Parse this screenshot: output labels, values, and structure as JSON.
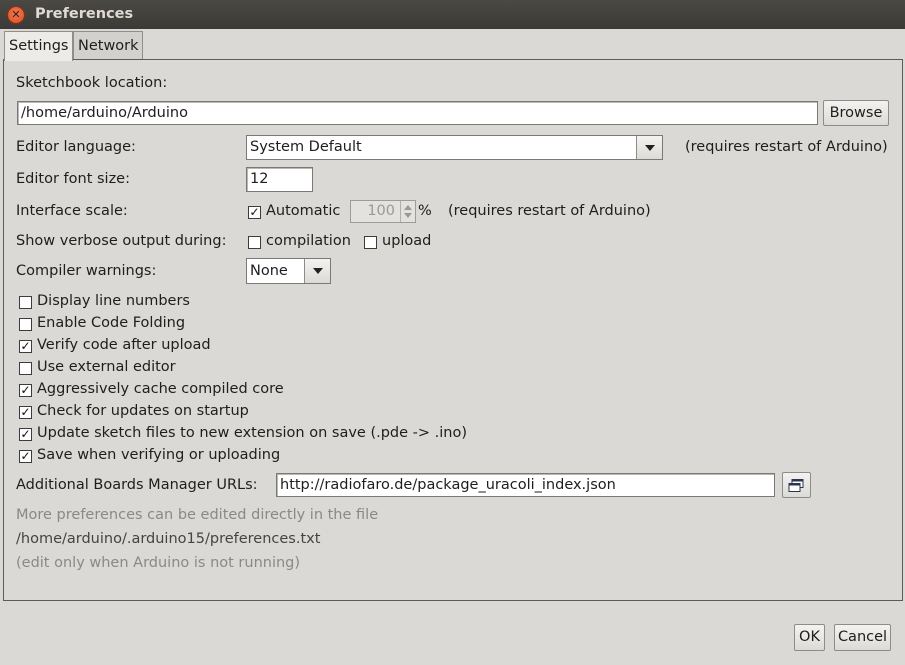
{
  "window": {
    "title": "Preferences"
  },
  "tabs": [
    {
      "label": "Settings"
    },
    {
      "label": "Network"
    }
  ],
  "settings": {
    "sketchbook_label": "Sketchbook location:",
    "sketchbook_value": "/home/arduino/Arduino",
    "browse_label": "Browse",
    "editor_language_label": "Editor language:",
    "editor_language_value": "System Default",
    "editor_language_note": "(requires restart of Arduino)",
    "font_size_label": "Editor font size:",
    "font_size_value": "12",
    "interface_scale_label": "Interface scale:",
    "automatic_label": "Automatic",
    "automatic_checked": true,
    "scale_value": "100",
    "scale_unit": "%",
    "scale_note": "(requires restart of Arduino)",
    "verbose_label": "Show verbose output during:",
    "compilation_label": "compilation",
    "compilation_checked": false,
    "upload_label": "upload",
    "upload_checked": false,
    "compiler_warnings_label": "Compiler warnings:",
    "compiler_warnings_value": "None",
    "checkboxes": [
      {
        "label": "Display line numbers",
        "checked": false
      },
      {
        "label": "Enable Code Folding",
        "checked": false
      },
      {
        "label": "Verify code after upload",
        "checked": true
      },
      {
        "label": "Use external editor",
        "checked": false
      },
      {
        "label": "Aggressively cache compiled core",
        "checked": true
      },
      {
        "label": "Check for updates on startup",
        "checked": true
      },
      {
        "label": "Update sketch files to new extension on save (.pde -> .ino)",
        "checked": true
      },
      {
        "label": "Save when verifying or uploading",
        "checked": true
      }
    ],
    "boards_url_label": "Additional Boards Manager URLs:",
    "boards_url_value": "http://radiofaro.de/package_uracoli_index.json",
    "more_prefs_note": "More preferences can be edited directly in the file",
    "prefs_path": "/home/arduino/.arduino15/preferences.txt",
    "edit_note": "(edit only when Arduino is not running)"
  },
  "footer": {
    "ok_label": "OK",
    "cancel_label": "Cancel"
  }
}
